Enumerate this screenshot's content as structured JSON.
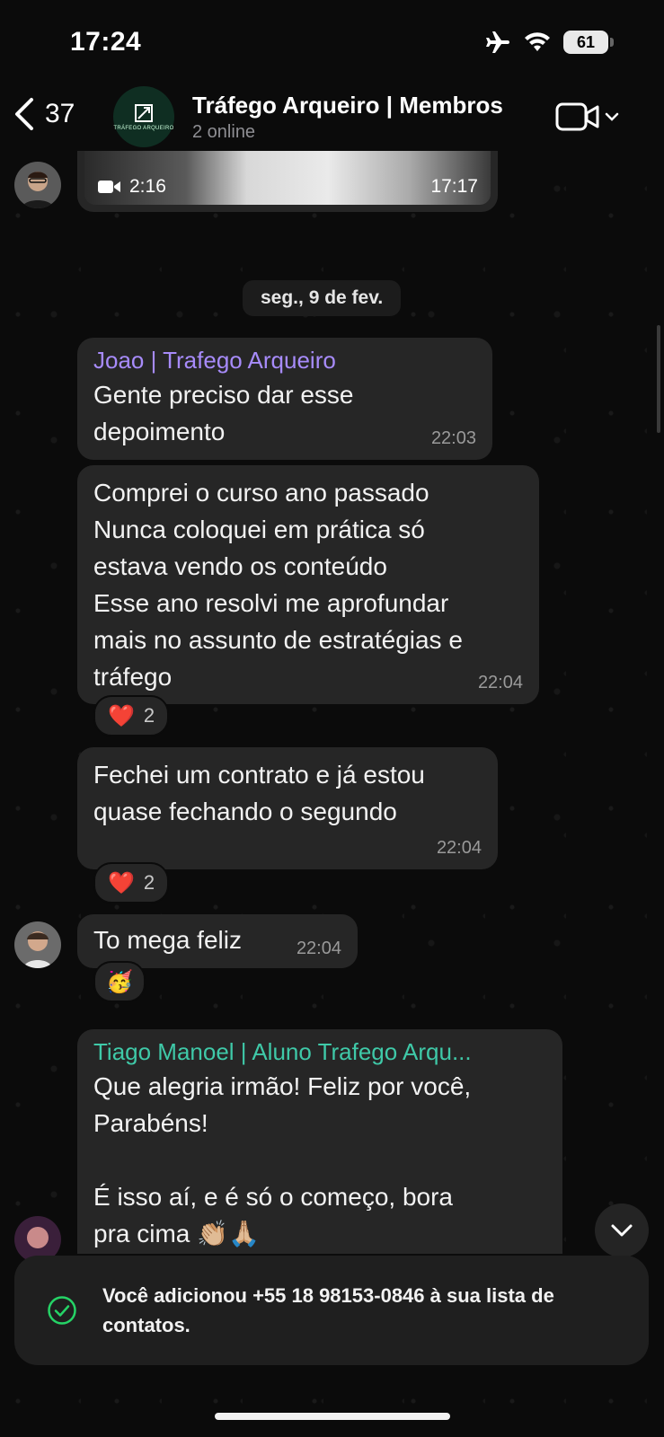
{
  "status_bar": {
    "time": "17:24",
    "battery": "61"
  },
  "header": {
    "back_count": "37",
    "group_name": "Tráfego Arqueiro | Membros",
    "group_status": "2 online",
    "group_avatar_text": "TRÁFEGO ARQUEIRO"
  },
  "chat": {
    "video_message": {
      "duration": "2:16",
      "time": "17:17"
    },
    "date_separator": "seg., 9 de fev.",
    "messages": [
      {
        "sender": "Joao | Trafego Arqueiro",
        "sender_color": "#a78bfa",
        "text": "Gente preciso dar esse\ndepoimento",
        "time": "22:03"
      },
      {
        "text": "Comprei o curso ano passado\nNunca coloquei em prática só\nestava vendo os conteúdo\nEsse ano resolvi me aprofundar\nmais no assunto de estratégias e\ntráfego",
        "time": "22:04",
        "reaction": {
          "emoji": "❤️",
          "count": "2"
        }
      },
      {
        "text": "Fechei um contrato e já estou\nquase fechando o segundo",
        "time": "22:04",
        "reaction": {
          "emoji": "❤️",
          "count": "2"
        }
      },
      {
        "text": "To mega feliz",
        "time": "22:04",
        "reaction": {
          "emoji": "🥳"
        }
      },
      {
        "sender": "Tiago Manoel | Aluno Trafego Arqu...",
        "sender_color": "#3fc9a8",
        "text": "Que alegria irmão! Feliz por você,\nParabéns!\n\nÉ isso aí, e é só o começo, bora\npra cima 👏🏼🙏🏼"
      }
    ]
  },
  "toast": {
    "text": "Você adicionou +55 18 98153-0846 à sua lista de contatos.",
    "icon": "check-circle-icon",
    "color": "#25d366"
  }
}
